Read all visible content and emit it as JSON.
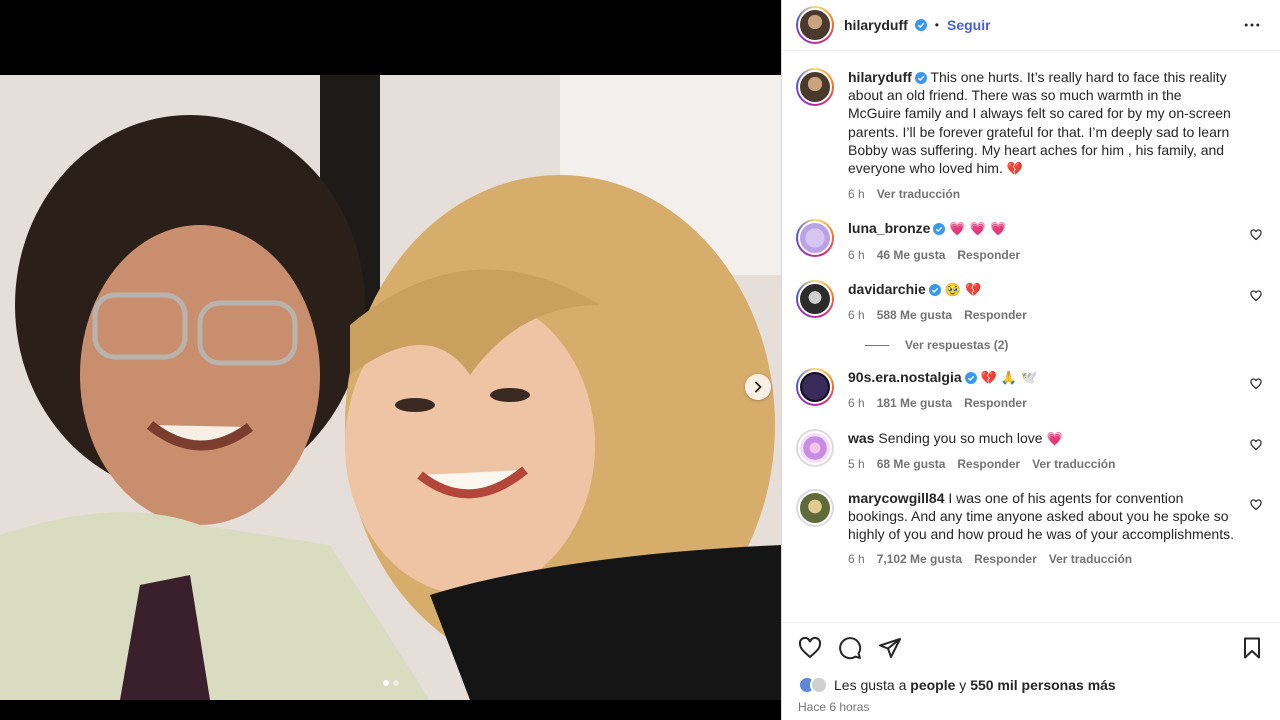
{
  "post": {
    "username": "hilaryduff",
    "follow_label": "Seguir",
    "separator": "•",
    "caption": "This one hurts. It’s really hard to face this reality about an old friend. There was so much warmth in the McGuire family and I always felt so cared for by my on-screen parents. I’ll be forever grateful for that. I’m deeply sad to learn Bobby was suffering. My heart aches for him , his family, and everyone who loved him.",
    "caption_emoji": "💔",
    "caption_time": "6 h",
    "caption_translate": "Ver traducción"
  },
  "comments": [
    {
      "username": "luna_bronze",
      "text": "",
      "emoji": "💗 💗 💗",
      "time": "6 h",
      "likes": "46 Me gusta",
      "reply": "Responder"
    },
    {
      "username": "davidarchie",
      "text": "",
      "emoji": "🥹 💔",
      "time": "6 h",
      "likes": "588 Me gusta",
      "reply": "Responder"
    },
    {
      "username": "90s.era.nostalgia",
      "text": "",
      "emoji": "💔 🙏 🕊️",
      "time": "6 h",
      "likes": "181 Me gusta",
      "reply": "Responder"
    },
    {
      "username": "was",
      "text": "Sending you so much love",
      "emoji": "💗",
      "time": "5 h",
      "likes": "68 Me gusta",
      "reply": "Responder",
      "translate": "Ver traducción"
    },
    {
      "username": "marycowgill84",
      "text": "I was one of his agents for convention bookings. And any time anyone asked about you he spoke so highly of you and how proud he was of your accomplishments.",
      "emoji": "",
      "time": "6 h",
      "likes": "7,102 Me gusta",
      "reply": "Responder",
      "translate": "Ver traducción"
    }
  ],
  "view_replies": "Ver respuestas (2)",
  "likes_summary": {
    "prefix": "Les gusta a",
    "first": "people",
    "middle": "y",
    "others": "550 mil personas más",
    "avatar_label": "People"
  },
  "posted_ago": "Hace 6 horas",
  "carousel": {
    "current": 1,
    "total": 2
  },
  "colors": {
    "follow": "#4a5fd3",
    "verified": "#3897f0",
    "heart": "#e0245e"
  }
}
